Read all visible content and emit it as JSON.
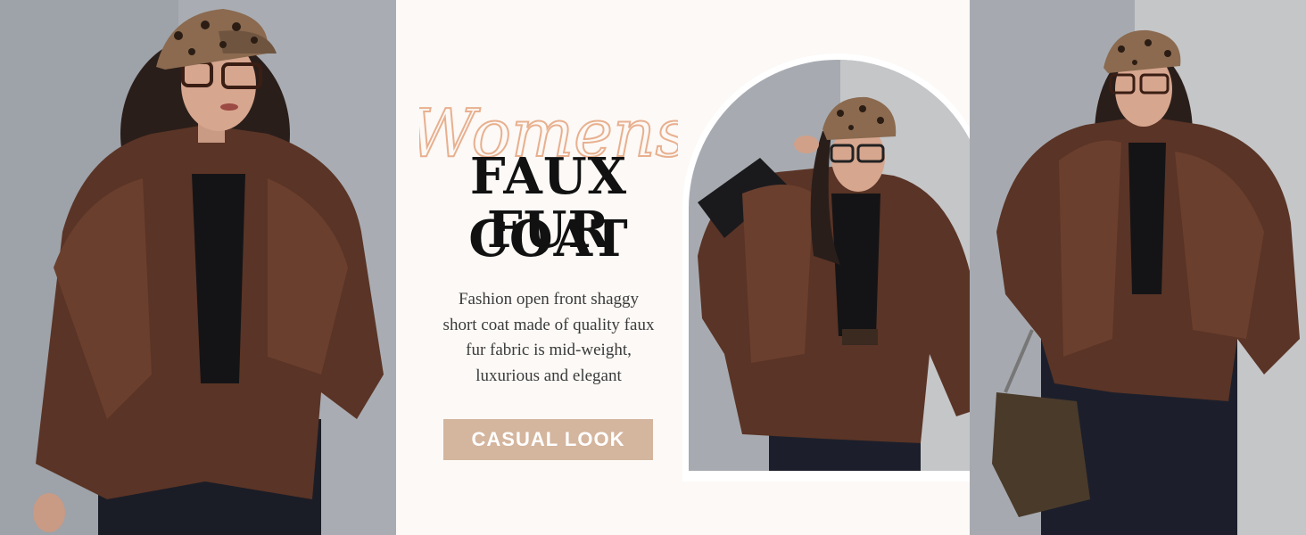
{
  "banner": {
    "script_word": "Womens",
    "headline_line1": "FAUX FUR",
    "headline_line2": "COAT",
    "description_lines": [
      "Fashion open front shaggy",
      "short coat made of quality faux",
      "fur fabric is mid-weight,",
      "luxurious and elegant"
    ],
    "cta_label": "CASUAL LOOK"
  },
  "colors": {
    "panel_background": "#fcf9f6",
    "script_accent": "#e8b08f",
    "headline": "#111111",
    "cta_background": "#d4b59e",
    "coat": "#5a3426"
  },
  "images": {
    "left": "model-faux-fur-coat-front-photo",
    "center": "model-faux-fur-coat-arch-photo",
    "right": "model-faux-fur-coat-with-bag-photo"
  }
}
